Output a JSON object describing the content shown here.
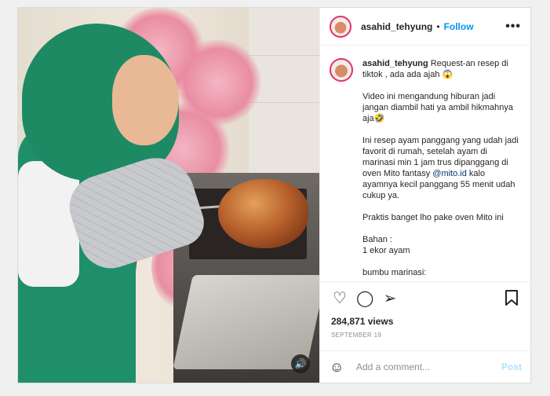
{
  "post": {
    "username": "asahid_tehyung",
    "separator": "•",
    "follow_label": "Follow",
    "more_label": "•••"
  },
  "caption": {
    "username": "asahid_tehyung",
    "intro": " Request-an resep di tiktok , ada ada ajah 😱",
    "p1": "Video ini mengandung hiburan jadi jangan diambil hati ya ambil hikmahnya aja🤣",
    "p2_a": "Ini resep ayam panggang yang udah jadi favorit di rumah, setelah ayam di marinasi min 1 jam trus dipanggang di oven Mito fantasy ",
    "p2_mention": "@mito.id",
    "p2_b": " kalo ayamnya kecil panggang 55 menit udah cukup ya.",
    "p3": "Praktis banget lho pake oven Mito ini",
    "p4_title": "Bahan :",
    "p4_item": "1 ekor ayam",
    "p5_title": "bumbu marinasi:"
  },
  "stats": {
    "views": "284,871 views",
    "date": "SEPTEMBER 19"
  },
  "comment": {
    "placeholder": "Add a comment...",
    "post_label": "Post"
  },
  "icons": {
    "like": "heart-icon",
    "comment": "comment-icon",
    "share": "share-icon",
    "bookmark": "bookmark-icon",
    "emoji": "emoji-icon",
    "sound": "speaker-icon"
  },
  "colors": {
    "accent": "#0095f6",
    "post_disabled": "#b2dffc",
    "muted": "#8e8e8e"
  }
}
